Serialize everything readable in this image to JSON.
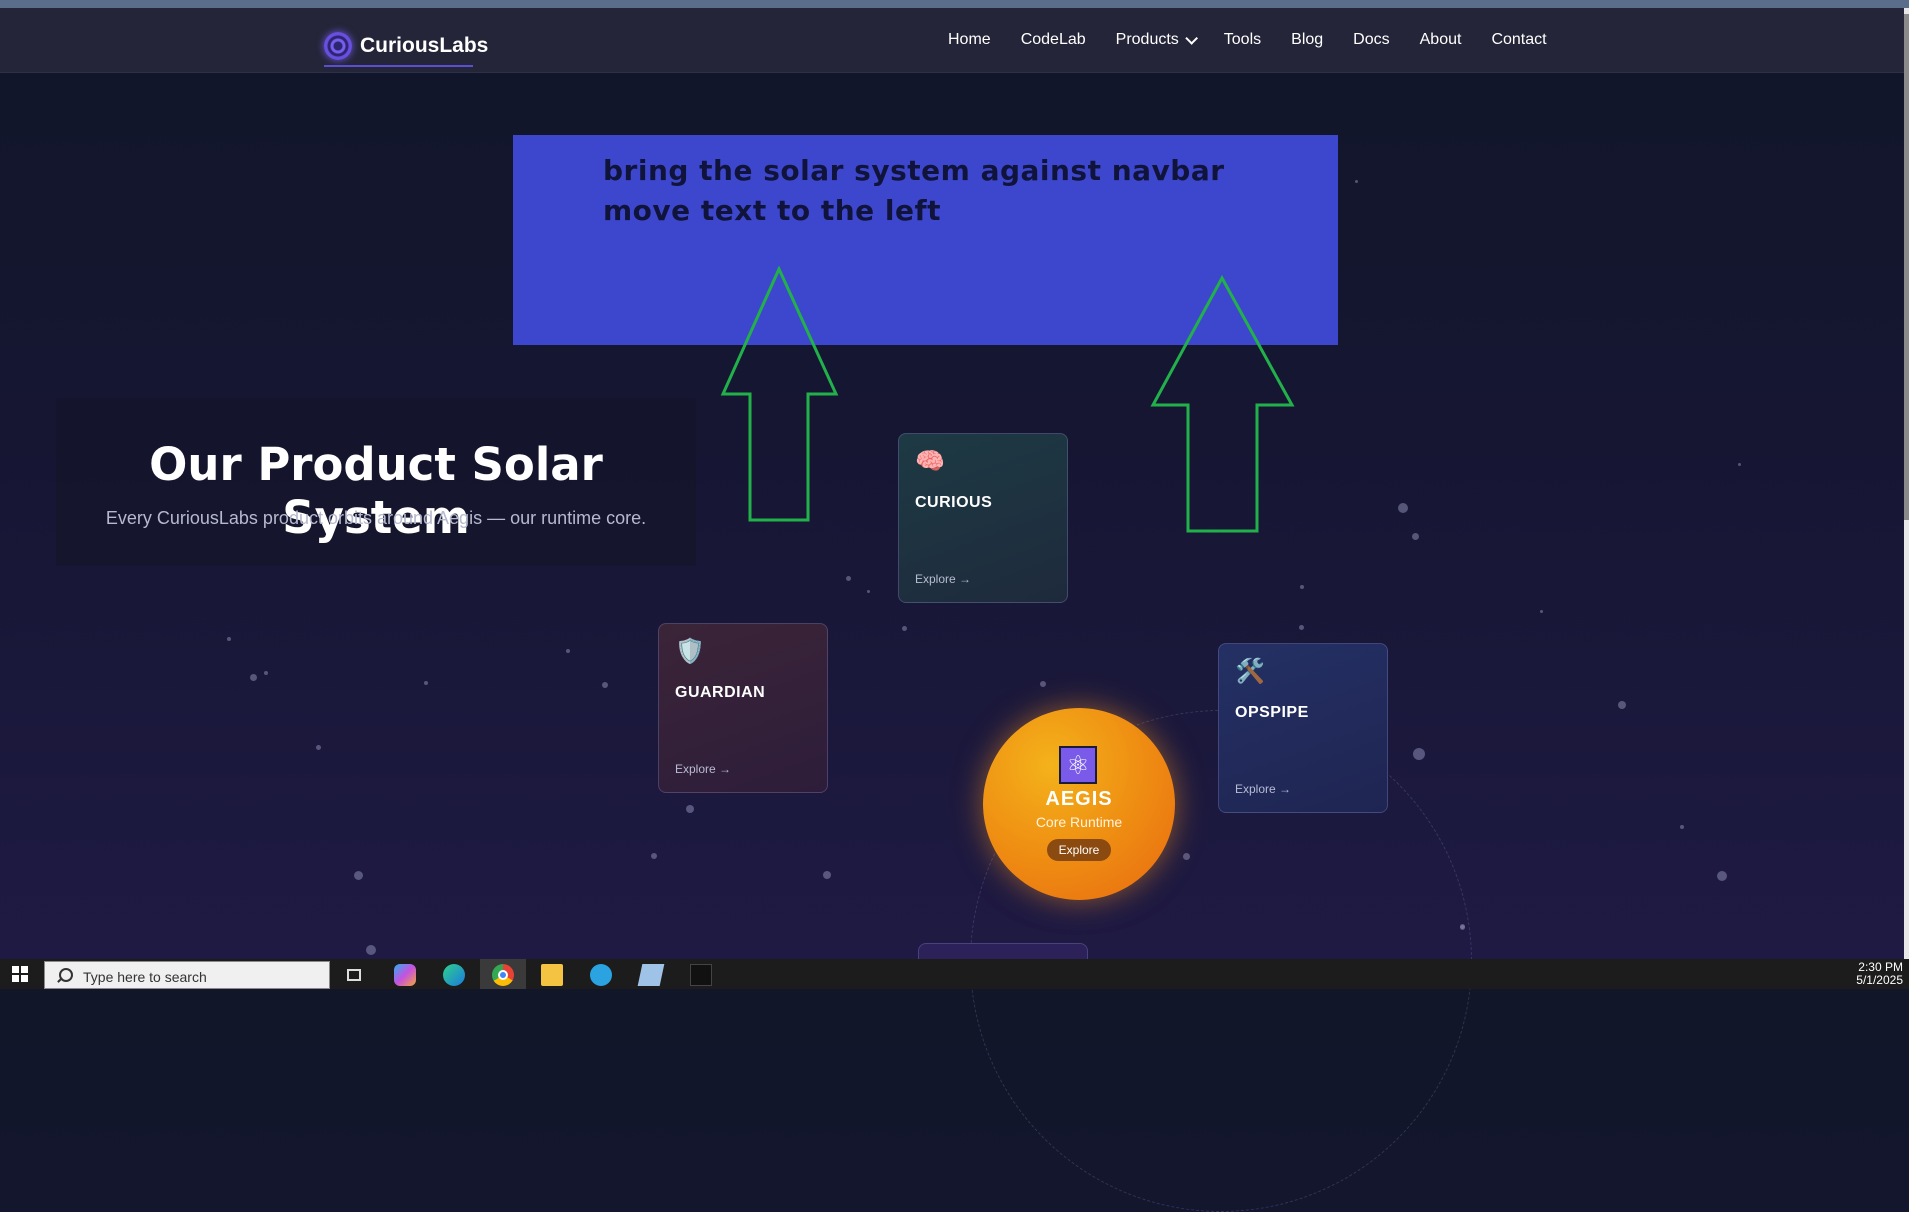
{
  "nav": {
    "brand": "CuriousLabs",
    "links": [
      "Home",
      "CodeLab",
      "Products",
      "Tools",
      "Blog",
      "Docs",
      "About",
      "Contact"
    ]
  },
  "annotation": {
    "line1": "bring the solar system against navbar",
    "line2": "move text to the left"
  },
  "hero": {
    "title": "Our Product Solar System",
    "subtitle": "Every CuriousLabs product orbits around Aegis — our runtime core."
  },
  "products": {
    "curious": {
      "icon": "brain-icon",
      "title": "CURIOUS",
      "link": "Explore →"
    },
    "guardian": {
      "icon": "shield-icon",
      "title": "GUARDIAN",
      "link": "Explore →"
    },
    "opspipe": {
      "icon": "tools-icon",
      "title": "OPSPIPE",
      "link": "Explore →"
    }
  },
  "core": {
    "icon": "atom-icon",
    "title": "AEGIS",
    "subtitle": "Core Runtime",
    "button": "Explore"
  },
  "taskbar": {
    "search_placeholder": "Type here to search",
    "time": "2:30 PM",
    "date": "5/1/2025"
  },
  "colors": {
    "annotation_box": "#3d47cd",
    "annotation_arrows": "#22b04a",
    "sun": "#ee8a12"
  }
}
